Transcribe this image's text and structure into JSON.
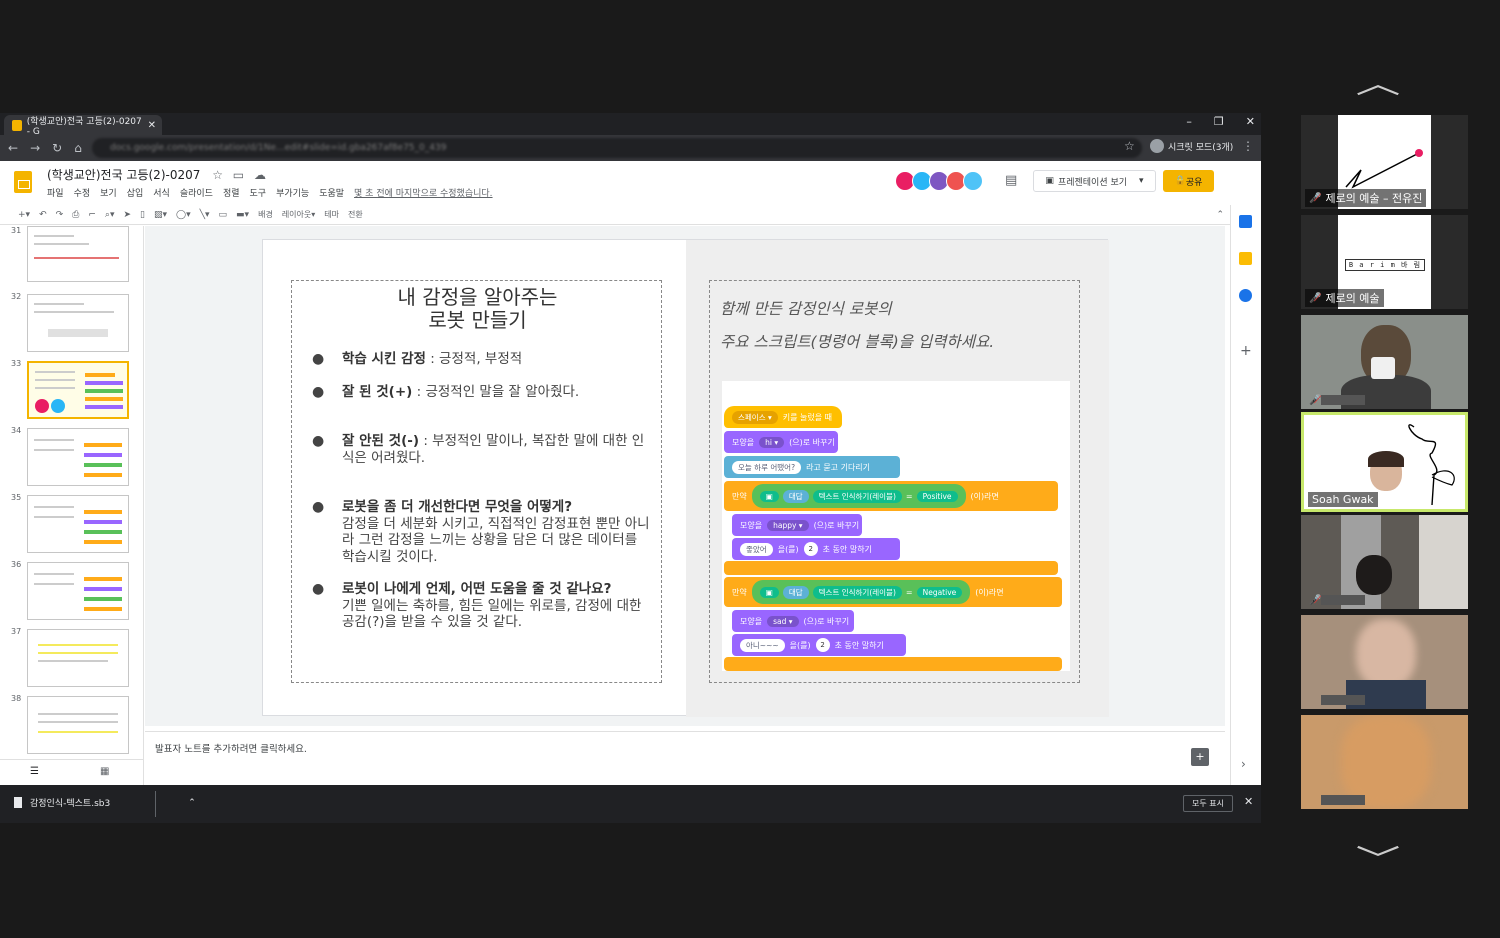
{
  "browser": {
    "tab_title": "(학생교안)전국 고등(2)-0207 - G",
    "url": "docs.google.com/presentation/d/1Ne...edit#slide=id.gba267af8e75_0_439",
    "incognito_label": "시크릿 모드(3개)",
    "window_controls": [
      "–",
      "❐",
      "✕"
    ]
  },
  "slides_app": {
    "doc_title": "(학생교안)전국 고등(2)-0207",
    "menus": [
      "파일",
      "수정",
      "보기",
      "삽입",
      "서식",
      "슬라이드",
      "정렬",
      "도구",
      "부가기능",
      "도움말"
    ],
    "last_edit": "몇 초 전에 마지막으로 수정했습니다.",
    "present_label": "프레젠테이션 보기",
    "share_label": "공유",
    "toolbar_labels": [
      "배경",
      "레이아웃▾",
      "테마",
      "전환"
    ],
    "collaborator_colors": [
      "#e91e63",
      "#29b6f6",
      "#7e57c2",
      "#ef5350",
      "#4fc3f7"
    ]
  },
  "filmstrip": {
    "slides": [
      {
        "num": "31"
      },
      {
        "num": "32"
      },
      {
        "num": "33",
        "selected": true
      },
      {
        "num": "34"
      },
      {
        "num": "35"
      },
      {
        "num": "36"
      },
      {
        "num": "37"
      },
      {
        "num": "38"
      }
    ]
  },
  "slide": {
    "title_line1": "내 감정을 알아주는",
    "title_line2": "로봇 만들기",
    "bullets": [
      {
        "bold": "학습 시킨 감정",
        "text": " : 긍정적, 부정적"
      },
      {
        "bold": "잘 된 것(+)",
        "text": " : 긍정적인 말을 잘 알아줬다."
      },
      {
        "bold": "잘 안된 것(-)",
        "text": " : 부정적인 말이나, 복잡한 말에 대한 인식은 어려웠다."
      },
      {
        "bold": "로봇을 좀 더 개선한다면 무엇을 어떻게?",
        "text": "감정을 더 세분화 시키고, 직접적인 감정표현 뿐만 아니라 그런 감정을 느끼는 상황을 담은 더 많은 데이터를 학습시킬 것이다."
      },
      {
        "bold": "로봇이 나에게 언제, 어떤 도움을 줄 것 같나요?",
        "text": "기쁜 일에는 축하를, 힘든 일에는 위로를, 감정에 대한 공감(?)을 받을 수 있을 것 같다."
      }
    ],
    "instr_line1": "함께 만든 감정인식 로봇의",
    "instr_line2": "주요 스크립트(명령어 블록)을 입력하세요.",
    "blocks": {
      "hat_key": "스페이스 ▾",
      "hat_text": "키를 눌렀을 때",
      "costume_label": "모양을",
      "costume_hi": "hi ▾",
      "costume_suffix": "(으)로 바꾸기",
      "ask_text": "오늘 하루 어땠어?",
      "ask_suffix": "라고 묻고 기다리기",
      "if_label": "만약",
      "answer": "대답",
      "recognize": "텍스트 인식하기(레이블)",
      "equals": "=",
      "positive": "Positive",
      "then": "(이)라면",
      "costume_happy": "happy ▾",
      "say_good": "좋았어",
      "say_label": "을(를)",
      "seconds": "2",
      "say_suffix": "초 동안 말하기",
      "negative": "Negative",
      "costume_sad": "sad ▾",
      "say_bad": "아니~~~"
    }
  },
  "notes": {
    "placeholder": "발표자 노트를 추가하려면 클릭하세요."
  },
  "download": {
    "file": "감정인식-텍스트.sb3",
    "show_all": "모두 표시"
  },
  "participants": [
    {
      "name": "제로의 예술 – 전유진",
      "muted": true
    },
    {
      "name": "제로의 예술",
      "muted": true
    },
    {
      "name": "",
      "muted": true
    },
    {
      "name": "Soah Gwak",
      "muted": false,
      "active": true
    },
    {
      "name": "",
      "muted": true
    },
    {
      "name": "",
      "muted": false
    },
    {
      "name": "",
      "muted": false
    }
  ],
  "tile2_logo": "B a r i m 바 림"
}
